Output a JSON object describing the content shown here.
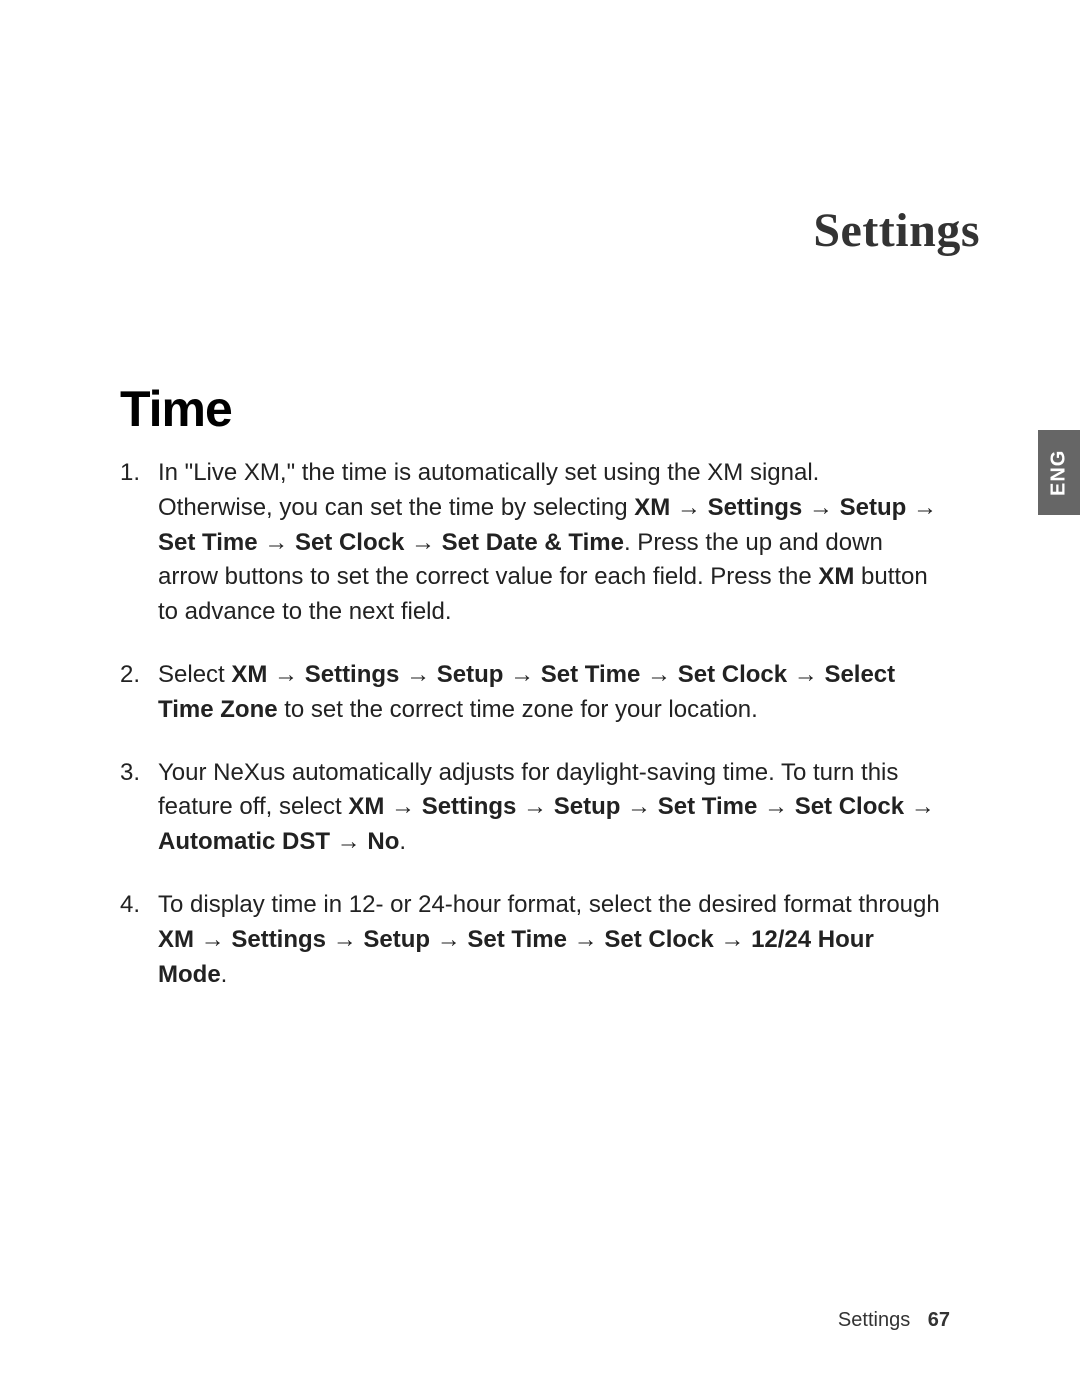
{
  "header": {
    "title": "Settings"
  },
  "tab": {
    "label": "ENG"
  },
  "section": {
    "title": "Time"
  },
  "steps": {
    "s1_a": "In \"Live XM,\" the time is automatically set using the XM signal. Otherwise, you can set the time by selecting ",
    "s1_b1": "XM",
    "s1_b2": "Settings",
    "s1_b3": "Setup",
    "s1_b4": "Set Time",
    "s1_b5": "Set Clock",
    "s1_b6": "Set Date & Time",
    "s1_c": ". Press the up and down arrow buttons to set the correct value for each field. Press the ",
    "s1_d": "XM",
    "s1_e": " button to advance to the next field.",
    "s2_a": "Select ",
    "s2_b1": "XM",
    "s2_b2": "Settings",
    "s2_b3": "Setup",
    "s2_b4": "Set Time",
    "s2_b5": "Set Clock",
    "s2_b6": "Select Time Zone",
    "s2_c": " to set the correct time zone for your location.",
    "s3_a": "Your NeXus automatically adjusts for daylight-saving time. To turn this feature off, select ",
    "s3_b1": "XM",
    "s3_b2": "Settings",
    "s3_b3": "Setup",
    "s3_b4": "Set Time",
    "s3_b5": "Set Clock",
    "s3_b6": "Automatic DST",
    "s3_b7": "No",
    "s3_c": ".",
    "s4_a": "To display time in 12- or 24-hour format, select the desired format through ",
    "s4_b1": "XM",
    "s4_b2": "Settings",
    "s4_b3": "Setup",
    "s4_b4": "Set Time",
    "s4_b5": "Set Clock",
    "s4_b6": "12/24 Hour Mode",
    "s4_c": "."
  },
  "arrow": " → ",
  "footer": {
    "section": "Settings",
    "page": "67"
  }
}
